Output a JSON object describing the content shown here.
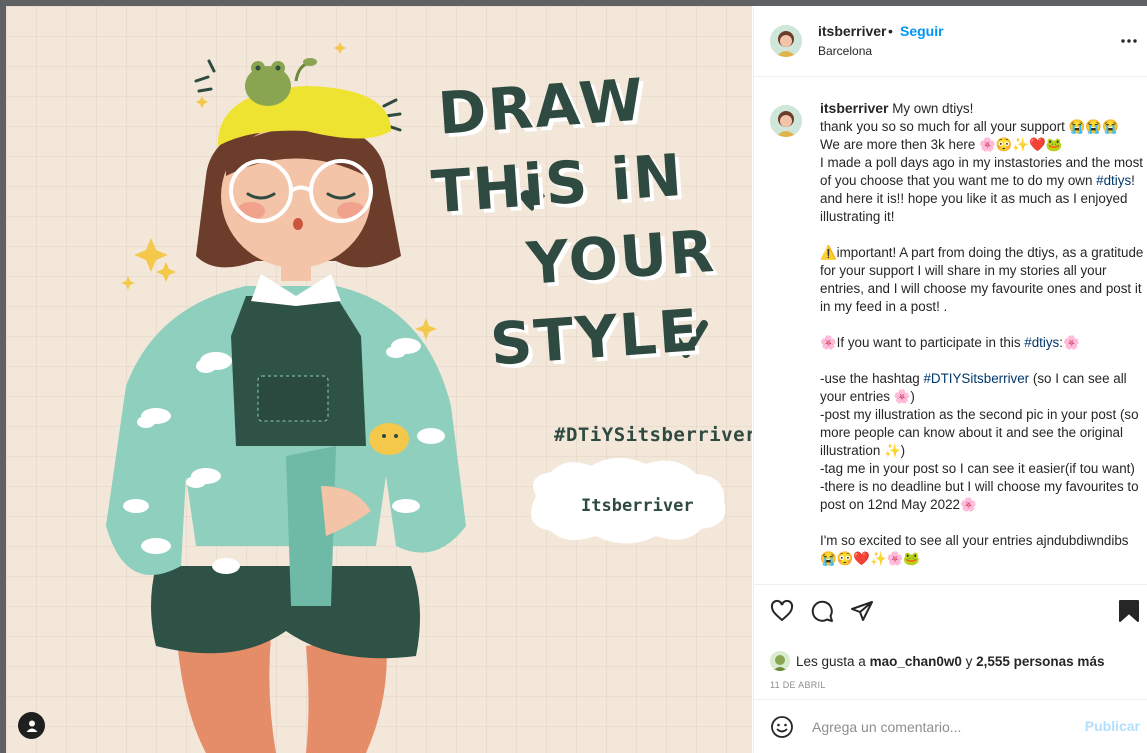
{
  "post": {
    "artwork": {
      "title_lines": [
        "DRAW",
        "THiS iN",
        "YOUR",
        "STYLE"
      ],
      "hashtag": "#DTiYSitsberriver",
      "cloud_label": "Itsberriver"
    }
  },
  "header": {
    "username": "itsberriver",
    "separator": "•",
    "follow_label": "Seguir",
    "location": "Barcelona"
  },
  "caption": {
    "username": "itsberriver",
    "lines": [
      " My own dtiys!",
      "thank you so so much for all your support 😭😭😭",
      "We are more then 3k here 🌸😳✨❤️🐸",
      "I made a poll days ago in my instastories and the most of you choose that you want me to do my own ",
      "#dtiys",
      "! and here it is!! hope you like it as much as I enjoyed illustrating it!",
      "⚠️important! A part from doing the dtiys, as a gratitude for your support I will share in my stories all your entries, and I will choose my favourite ones and post it in my feed in a post! .",
      "🌸If you want to participate in this ",
      "#dtiys",
      ":🌸",
      "-use the hashtag ",
      "#DTIYSitsberriver",
      " (so I can see all your entries 🌸)",
      "-post my illustration as the second pic in your post (so more people can know about it and see the original illustration ✨)",
      "-tag me in your post so I can see it easier(if tou want)",
      "-there is no deadline but I will choose my favourites to post on 12nd May 2022🌸",
      "I'm so excited to see all your entries ajndubdiwndibs",
      "😭😳❤️✨🌸🐸"
    ]
  },
  "likes": {
    "prefix": "Les gusta a ",
    "first_user": "mao_chan0w0",
    "middle": " y ",
    "others": "2,555 personas más"
  },
  "date": "11 DE ABRIL",
  "comment": {
    "placeholder": "Agrega un comentario...",
    "publish_label": "Publicar"
  },
  "colors": {
    "background_art": "#f3e7da",
    "ink_green": "#2f4a41",
    "link_blue": "#0095f6",
    "hashtag_blue": "#00376b"
  }
}
